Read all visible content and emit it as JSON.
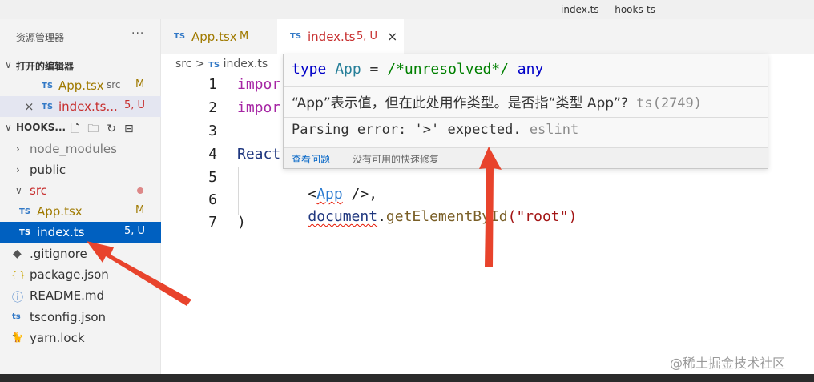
{
  "window": {
    "title": "index.ts — hooks-ts"
  },
  "sidebar": {
    "header": "资源管理器",
    "more": "···",
    "open_editors": {
      "title": "打开的编辑器",
      "items": [
        {
          "lang": "TS",
          "name": "App.tsx",
          "dir": "src",
          "status": "M"
        },
        {
          "lang": "TS",
          "name": "index.ts...",
          "status": "5, U"
        }
      ]
    },
    "project": {
      "title": "HOOKS...",
      "items": [
        {
          "name": "node_modules"
        },
        {
          "name": "public"
        },
        {
          "name": "src"
        },
        {
          "lang": "TS",
          "name": "App.tsx",
          "status": "M"
        },
        {
          "lang": "TS",
          "name": "index.ts",
          "status": "5, U"
        },
        {
          "icon": "◆",
          "name": ".gitignore"
        },
        {
          "icon": "{ }",
          "name": "package.json"
        },
        {
          "icon": "ⓘ",
          "name": "README.md"
        },
        {
          "icon": "ts",
          "name": "tsconfig.json"
        },
        {
          "icon": "🐈",
          "name": "yarn.lock"
        }
      ]
    }
  },
  "tabs": [
    {
      "lang": "TS",
      "name": "App.tsx",
      "status": "M"
    },
    {
      "lang": "TS",
      "name": "index.ts",
      "status": "5, U",
      "close": "×"
    }
  ],
  "breadcrumb": {
    "folder": "src",
    "sep": ">",
    "lang": "TS",
    "file": "index.ts"
  },
  "code": {
    "line_numbers": [
      "1",
      "2",
      "3",
      "4",
      "5",
      "6",
      "7"
    ],
    "l1": "impor",
    "l2": "impor",
    "l4": "React",
    "l5_a": "<",
    "l5_b": "App",
    "l5_c": " />,",
    "l6_a": "document",
    "l6_b": ".",
    "l6_c": "getElementById",
    "l6_d": "(\"root\")",
    "l7": ")"
  },
  "hover": {
    "sig_kw": "type",
    "sig_name": " App",
    "sig_eq": " = ",
    "sig_comment": "/*unresolved*/",
    "sig_any": " any",
    "message": "“App”表示值，但在此处用作类型。是否指“类型 App”?",
    "message_source": " ts(2749)",
    "lint_message": "Parsing error: '>' expected.",
    "lint_source": " eslint",
    "action_view": "查看问题",
    "action_nofix": "没有可用的快速修复"
  },
  "watermark": "@稀土掘金技术社区",
  "colors": {
    "selection": "#0060c0",
    "arrow": "#e8432c",
    "error": "#c72e2e",
    "modified": "#a07a00"
  }
}
